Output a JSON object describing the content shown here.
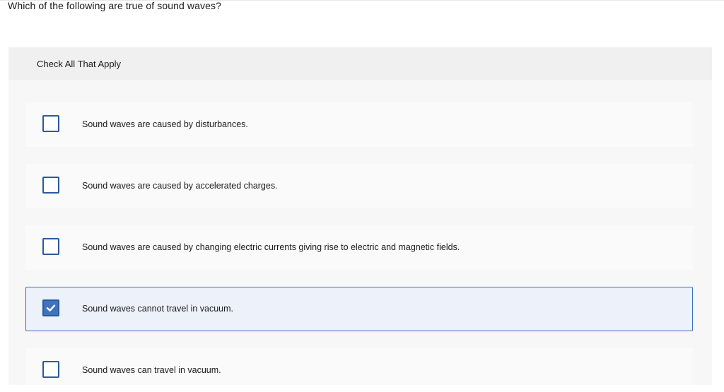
{
  "question": {
    "text": "Which of the following are true of sound waves?"
  },
  "panel": {
    "instruction": "Check All That Apply"
  },
  "options": [
    {
      "label": "Sound waves are caused by disturbances.",
      "checked": false
    },
    {
      "label": "Sound waves are caused by accelerated charges.",
      "checked": false
    },
    {
      "label": "Sound waves are caused by changing electric currents giving rise to electric and magnetic fields.",
      "checked": false
    },
    {
      "label": "Sound waves cannot travel in vacuum.",
      "checked": true
    },
    {
      "label": "Sound waves can travel in vacuum.",
      "checked": false
    }
  ],
  "colors": {
    "accent": "#3f73bd",
    "checkbox_border": "#2c5a9c",
    "selected_background": "#ecf1fa",
    "selected_border": "#3b6fb6"
  },
  "icons": {
    "checked": "check-icon"
  }
}
